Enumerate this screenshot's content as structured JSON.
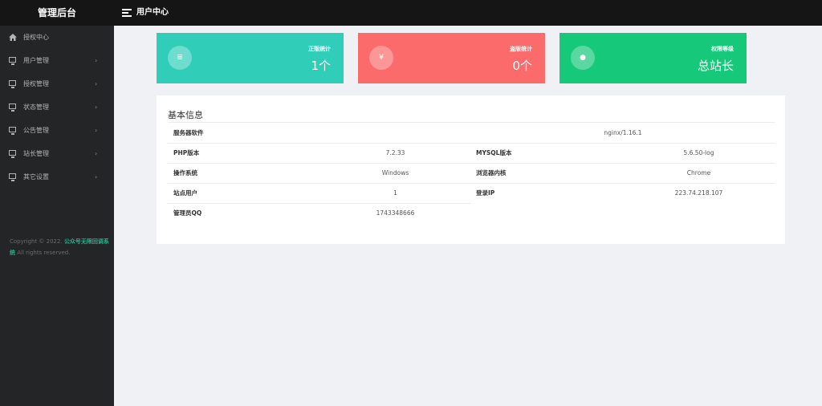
{
  "header": {
    "brand": "管理后台",
    "title": "用户中心"
  },
  "sidebar": {
    "items": [
      {
        "label": "授权中心",
        "icon": "home-icon"
      },
      {
        "label": "用户管理",
        "icon": "monitor-icon"
      },
      {
        "label": "授权管理",
        "icon": "monitor-icon"
      },
      {
        "label": "状态管理",
        "icon": "monitor-icon"
      },
      {
        "label": "公告管理",
        "icon": "monitor-icon"
      },
      {
        "label": "站长管理",
        "icon": "monitor-icon"
      },
      {
        "label": "其它设置",
        "icon": "monitor-icon"
      }
    ],
    "chevron": "›",
    "copyright": {
      "prefix": "Copyright © 2022.",
      "highlight": "公众号无限回调系统",
      "suffix": "All rights reserved."
    }
  },
  "stats": [
    {
      "label": "正版统计",
      "value": "1个",
      "icon": "list-icon",
      "icon_glyph": "≣",
      "color": "#30cdb9"
    },
    {
      "label": "盗版统计",
      "value": "0个",
      "icon": "yen-icon",
      "icon_glyph": "¥",
      "color": "#fb6b6b"
    },
    {
      "label": "权限等级",
      "value": "总站长",
      "icon": "user-circle-icon",
      "icon_glyph": "●",
      "color": "#15c87a"
    }
  ],
  "info": {
    "title": "基本信息",
    "rows": [
      {
        "k1": "服务器软件",
        "v1": "nginx/1.16.1"
      },
      {
        "k1": "PHP版本",
        "v1": "7.2.33",
        "k2": "MYSQL版本",
        "v2": "5.6.50-log"
      },
      {
        "k1": "操作系统",
        "v1": "Windows",
        "k2": "浏览器内核",
        "v2": "Chrome"
      },
      {
        "k1": "站点用户",
        "v1": "1",
        "k2": "登录IP",
        "v2": "223.74.218.107"
      },
      {
        "k1": "管理员QQ",
        "v1": "1743348666"
      }
    ]
  }
}
